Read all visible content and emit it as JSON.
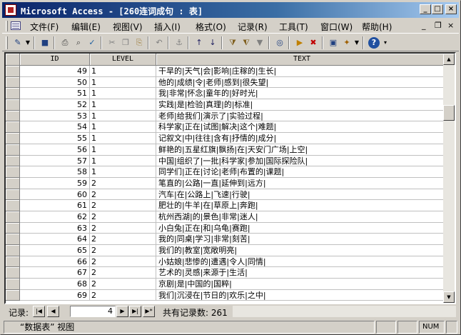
{
  "window": {
    "title": "Microsoft Access - [260连词成句 : 表]",
    "controls": {
      "minimize": "_",
      "maximize": "□",
      "close": "×"
    }
  },
  "menubar": {
    "items": [
      {
        "label": "文件(F)"
      },
      {
        "label": "编辑(E)"
      },
      {
        "label": "视图(V)"
      },
      {
        "label": "插入(I)"
      },
      {
        "label": "格式(O)"
      },
      {
        "label": "记录(R)"
      },
      {
        "label": "工具(T)"
      },
      {
        "label": "窗口(W)"
      },
      {
        "label": "帮助(H)"
      }
    ],
    "mdi": {
      "minimize": "_",
      "restore": "❐",
      "close": "×"
    }
  },
  "toolbar": {
    "icons": [
      {
        "name": "design-view-icon",
        "glyph": "✎",
        "color": "#204080"
      },
      {
        "name": "save-icon",
        "glyph": "■",
        "color": "#204080"
      },
      {
        "name": "print-icon",
        "glyph": "⎙",
        "color": "#404040"
      },
      {
        "name": "print-preview-icon",
        "glyph": "⌕",
        "color": "#404040"
      },
      {
        "name": "spelling-icon",
        "glyph": "✓",
        "color": "#2060a0"
      },
      {
        "name": "cut-icon",
        "glyph": "✂",
        "color": "#808080"
      },
      {
        "name": "copy-icon",
        "glyph": "❐",
        "color": "#808080"
      },
      {
        "name": "paste-icon",
        "glyph": "⎘",
        "color": "#a08040"
      },
      {
        "name": "undo-icon",
        "glyph": "↶",
        "color": "#808080"
      },
      {
        "name": "insert-hyperlink-icon",
        "glyph": "⚓",
        "color": "#808080"
      },
      {
        "name": "sort-ascending-icon",
        "glyph": "↑",
        "color": "#202060"
      },
      {
        "name": "sort-descending-icon",
        "glyph": "↓",
        "color": "#202060"
      },
      {
        "name": "filter-by-selection-icon",
        "glyph": "⧩",
        "color": "#806020"
      },
      {
        "name": "filter-by-form-icon",
        "glyph": "⧨",
        "color": "#806020"
      },
      {
        "name": "apply-filter-icon",
        "glyph": "▼",
        "color": "#808080"
      },
      {
        "name": "find-icon",
        "glyph": "◎",
        "color": "#204080"
      },
      {
        "name": "new-record-icon",
        "glyph": "▶",
        "color": "#c08000"
      },
      {
        "name": "delete-record-icon",
        "glyph": "✖",
        "color": "#c00000"
      },
      {
        "name": "database-window-icon",
        "glyph": "▣",
        "color": "#204080"
      },
      {
        "name": "new-object-icon",
        "glyph": "✦",
        "color": "#a06000"
      },
      {
        "name": "help-icon",
        "glyph": "?",
        "color": "#2050a0"
      }
    ]
  },
  "datasheet": {
    "columns": [
      "ID",
      "LEVEL",
      "TEXT"
    ],
    "rows": [
      {
        "id": "49",
        "level": "1",
        "text": "干旱的|天气|会|影响|庄稼的|生长|"
      },
      {
        "id": "50",
        "level": "1",
        "text": "他的|成绩|令|老师|感到|很失望|"
      },
      {
        "id": "51",
        "level": "1",
        "text": "我|非常|怀念|童年的|好时光|"
      },
      {
        "id": "52",
        "level": "1",
        "text": "实践|是|检验|真理|的|标准|"
      },
      {
        "id": "53",
        "level": "1",
        "text": "老师|给我们|演示了|实验过程|"
      },
      {
        "id": "54",
        "level": "1",
        "text": "科学家|正在|试图|解决|这个|难题|"
      },
      {
        "id": "55",
        "level": "1",
        "text": "记叙文|中|往往|含有|抒情的|成分|"
      },
      {
        "id": "56",
        "level": "1",
        "text": "鲜艳的|五星红旗|飘扬|在|天安门广场|上空|"
      },
      {
        "id": "57",
        "level": "1",
        "text": "中国|组织了|一批|科学家|参加|国际探险队|"
      },
      {
        "id": "58",
        "level": "1",
        "text": "同学们|正在|讨论|老师|布置的|课题|"
      },
      {
        "id": "59",
        "level": "2",
        "text": "笔直的|公路|一直|延伸到|远方|"
      },
      {
        "id": "60",
        "level": "2",
        "text": "汽车|在|公路上|飞速|行驶|"
      },
      {
        "id": "61",
        "level": "2",
        "text": "肥壮的|牛羊|在|草原上|奔跑|"
      },
      {
        "id": "62",
        "level": "2",
        "text": "杭州西湖|的|景色|非常|迷人|"
      },
      {
        "id": "63",
        "level": "2",
        "text": "小白兔|正在|和|乌龟|赛跑|"
      },
      {
        "id": "64",
        "level": "2",
        "text": "我的|同桌|学习|非常|刻苦|"
      },
      {
        "id": "65",
        "level": "2",
        "text": "我们的|教室|宽敞明亮|"
      },
      {
        "id": "66",
        "level": "2",
        "text": "小姑娘|悲惨的|遭遇|令人|同情|"
      },
      {
        "id": "67",
        "level": "2",
        "text": "艺术的|灵感|来源于|生活|"
      },
      {
        "id": "68",
        "level": "2",
        "text": "京剧|是|中国的|国粹|"
      },
      {
        "id": "69",
        "level": "2",
        "text": "我们|沉浸在|节日的|欢乐|之中|"
      }
    ]
  },
  "navigator": {
    "label": "记录:",
    "current": "4",
    "total_text": "共有记录数: 261",
    "first": "|◀",
    "prev": "◀",
    "next": "▶",
    "last": "▶|",
    "new": "▶*"
  },
  "statusbar": {
    "view": "“数据表” 视图",
    "num": "NUM"
  }
}
